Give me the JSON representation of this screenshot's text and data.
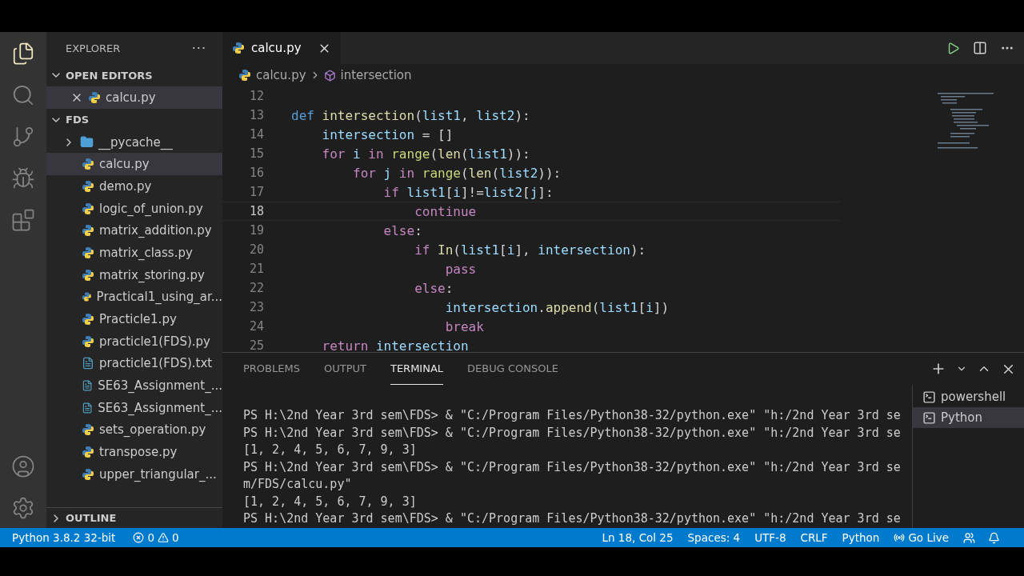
{
  "activity_bar": {
    "items": [
      {
        "kind": "files",
        "selected": true
      },
      {
        "kind": "search",
        "selected": false
      },
      {
        "kind": "source",
        "selected": false
      },
      {
        "kind": "debug",
        "selected": false
      },
      {
        "kind": "extensions",
        "selected": false
      }
    ],
    "bottom": [
      {
        "kind": "account"
      },
      {
        "kind": "settings"
      }
    ]
  },
  "sidebar": {
    "title": "EXPLORER",
    "more": "···",
    "open_editors": {
      "label": "OPEN EDITORS",
      "expanded": true,
      "items": [
        {
          "name": "calcu.py",
          "kind": "python"
        }
      ]
    },
    "folder": {
      "label": "FDS",
      "expanded": true,
      "items": [
        {
          "name": "__pycache__",
          "kind": "folder",
          "expanded": false,
          "selected": false
        },
        {
          "name": "calcu.py",
          "kind": "python",
          "selected": true
        },
        {
          "name": "demo.py",
          "kind": "python",
          "selected": false
        },
        {
          "name": "logic_of_union.py",
          "kind": "python",
          "selected": false
        },
        {
          "name": "matrix_addition.py",
          "kind": "python",
          "selected": false
        },
        {
          "name": "matrix_class.py",
          "kind": "python",
          "selected": false
        },
        {
          "name": "matrix_storing.py",
          "kind": "python",
          "selected": false
        },
        {
          "name": "Practical1_using_ar...",
          "kind": "python",
          "selected": false
        },
        {
          "name": "Practicle1.py",
          "kind": "python",
          "selected": false
        },
        {
          "name": "practicle1(FDS).py",
          "kind": "python",
          "selected": false
        },
        {
          "name": "practicle1(FDS).txt",
          "kind": "text",
          "selected": false
        },
        {
          "name": "SE63_Assignment_...",
          "kind": "text",
          "selected": false
        },
        {
          "name": "SE63_Assignment_...",
          "kind": "text",
          "selected": false
        },
        {
          "name": "sets_operation.py",
          "kind": "python",
          "selected": false
        },
        {
          "name": "transpose.py",
          "kind": "python",
          "selected": false
        },
        {
          "name": "upper_triangular_...",
          "kind": "python",
          "selected": false
        }
      ]
    },
    "outline": {
      "label": "OUTLINE",
      "expanded": false
    }
  },
  "editor": {
    "tabs": [
      {
        "label": "calcu.py",
        "selected": true
      }
    ],
    "breadcrumb": [
      {
        "label": "calcu.py",
        "kind": "file"
      },
      {
        "label": "intersection",
        "kind": "symbol"
      }
    ],
    "lines": [
      {
        "number": "12",
        "current": false
      },
      {
        "number": "13",
        "current": false,
        "tokens": [
          {
            "kind": "storage",
            "text": "def "
          },
          {
            "kind": "function",
            "text": "intersection"
          },
          {
            "kind": "plain",
            "text": "("
          },
          {
            "kind": "variable",
            "text": "list1"
          },
          {
            "kind": "plain",
            "text": ", "
          },
          {
            "kind": "variable",
            "text": "list2"
          },
          {
            "kind": "plain",
            "text": "):"
          }
        ]
      },
      {
        "number": "14",
        "current": false,
        "tokens": [
          {
            "kind": "variable",
            "text": "    intersection"
          },
          {
            "kind": "plain",
            "text": " = []"
          }
        ]
      },
      {
        "number": "15",
        "current": false,
        "tokens": [
          {
            "kind": "keyword",
            "text": "    for "
          },
          {
            "kind": "variable",
            "text": "i "
          },
          {
            "kind": "keyword",
            "text": "in "
          },
          {
            "kind": "builtin",
            "text": "range"
          },
          {
            "kind": "plain",
            "text": "("
          },
          {
            "kind": "function",
            "text": "len"
          },
          {
            "kind": "plain",
            "text": "("
          },
          {
            "kind": "variable",
            "text": "list1"
          },
          {
            "kind": "plain",
            "text": ")):"
          }
        ]
      },
      {
        "number": "16",
        "current": false,
        "tokens": [
          {
            "kind": "keyword",
            "text": "        for "
          },
          {
            "kind": "variable",
            "text": "j "
          },
          {
            "kind": "keyword",
            "text": "in "
          },
          {
            "kind": "builtin",
            "text": "range"
          },
          {
            "kind": "plain",
            "text": "("
          },
          {
            "kind": "function",
            "text": "len"
          },
          {
            "kind": "plain",
            "text": "("
          },
          {
            "kind": "variable",
            "text": "list2"
          },
          {
            "kind": "plain",
            "text": ")):"
          }
        ]
      },
      {
        "number": "17",
        "current": false,
        "tokens": [
          {
            "kind": "keyword",
            "text": "            if "
          },
          {
            "kind": "variable",
            "text": "list1"
          },
          {
            "kind": "plain",
            "text": "["
          },
          {
            "kind": "variable",
            "text": "i"
          },
          {
            "kind": "plain",
            "text": "]!="
          },
          {
            "kind": "variable",
            "text": "list2"
          },
          {
            "kind": "plain",
            "text": "["
          },
          {
            "kind": "variable",
            "text": "j"
          },
          {
            "kind": "plain",
            "text": "]:"
          }
        ]
      },
      {
        "number": "18",
        "current": true,
        "tokens": [
          {
            "kind": "keyword",
            "text": "                continue"
          }
        ]
      },
      {
        "number": "19",
        "current": false,
        "tokens": [
          {
            "kind": "keyword",
            "text": "            else"
          },
          {
            "kind": "plain",
            "text": ":"
          }
        ]
      },
      {
        "number": "20",
        "current": false,
        "tokens": [
          {
            "kind": "keyword",
            "text": "                if "
          },
          {
            "kind": "function",
            "text": "In"
          },
          {
            "kind": "plain",
            "text": "("
          },
          {
            "kind": "variable",
            "text": "list1"
          },
          {
            "kind": "plain",
            "text": "["
          },
          {
            "kind": "variable",
            "text": "i"
          },
          {
            "kind": "plain",
            "text": "], "
          },
          {
            "kind": "variable",
            "text": "intersection"
          },
          {
            "kind": "plain",
            "text": "):"
          }
        ]
      },
      {
        "number": "21",
        "current": false,
        "tokens": [
          {
            "kind": "keyword",
            "text": "                    pass"
          }
        ]
      },
      {
        "number": "22",
        "current": false,
        "tokens": [
          {
            "kind": "keyword",
            "text": "                else"
          },
          {
            "kind": "plain",
            "text": ":"
          }
        ]
      },
      {
        "number": "23",
        "current": false,
        "tokens": [
          {
            "kind": "variable",
            "text": "                    intersection"
          },
          {
            "kind": "plain",
            "text": "."
          },
          {
            "kind": "function",
            "text": "append"
          },
          {
            "kind": "plain",
            "text": "("
          },
          {
            "kind": "variable",
            "text": "list1"
          },
          {
            "kind": "plain",
            "text": "["
          },
          {
            "kind": "variable",
            "text": "i"
          },
          {
            "kind": "plain",
            "text": "])"
          }
        ]
      },
      {
        "number": "24",
        "current": false,
        "tokens": [
          {
            "kind": "keyword",
            "text": "                    break"
          }
        ]
      },
      {
        "number": "25",
        "current": false,
        "tokens": [
          {
            "kind": "keyword",
            "text": "    return "
          },
          {
            "kind": "variable",
            "text": "intersection"
          }
        ]
      }
    ]
  },
  "panel": {
    "tabs": [
      {
        "label": "PROBLEMS",
        "selected": false
      },
      {
        "label": "OUTPUT",
        "selected": false
      },
      {
        "label": "TERMINAL",
        "selected": true
      },
      {
        "label": "DEBUG CONSOLE",
        "selected": false
      }
    ],
    "terminal_lines": [
      "PS H:\\2nd Year 3rd sem\\FDS> & \"C:/Program Files/Python38-32/python.exe\" \"h:/2nd Year 3rd se",
      "PS H:\\2nd Year 3rd sem\\FDS> & \"C:/Program Files/Python38-32/python.exe\" \"h:/2nd Year 3rd se",
      "[1, 2, 4, 5, 6, 7, 9, 3]",
      "PS H:\\2nd Year 3rd sem\\FDS> & \"C:/Program Files/Python38-32/python.exe\" \"h:/2nd Year 3rd se",
      "m/FDS/calcu.py\"",
      "[1, 2, 4, 5, 6, 7, 9, 3]",
      "PS H:\\2nd Year 3rd sem\\FDS> & \"C:/Program Files/Python38-32/python.exe\" \"h:/2nd Year 3rd se"
    ],
    "terminals": [
      {
        "label": "powershell",
        "selected": false
      },
      {
        "label": "Python",
        "selected": true
      }
    ]
  },
  "status_bar": {
    "interpreter": "Python 3.8.2 32-bit",
    "errors": "0",
    "warnings": "0",
    "position": "Ln 18, Col 25",
    "spaces": "Spaces: 4",
    "encoding": "UTF-8",
    "eol": "CRLF",
    "language": "Python",
    "live": "Go Live"
  }
}
